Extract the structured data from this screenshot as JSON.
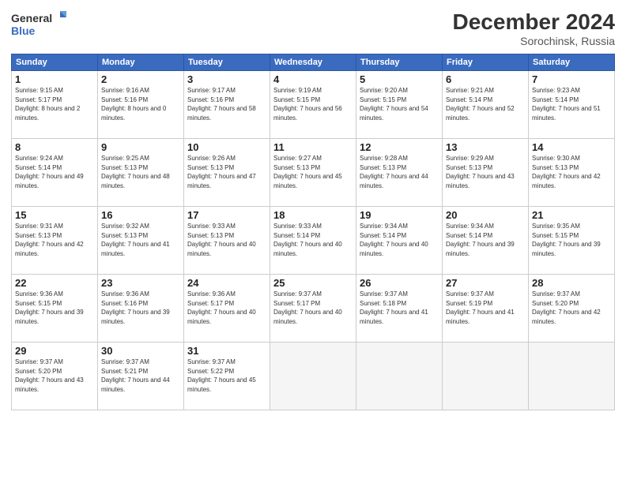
{
  "header": {
    "logo_line1": "General",
    "logo_line2": "Blue",
    "month": "December 2024",
    "location": "Sorochinsk, Russia"
  },
  "weekdays": [
    "Sunday",
    "Monday",
    "Tuesday",
    "Wednesday",
    "Thursday",
    "Friday",
    "Saturday"
  ],
  "weeks": [
    [
      {
        "day": "1",
        "rise": "Sunrise: 9:15 AM",
        "set": "Sunset: 5:17 PM",
        "daylight": "Daylight: 8 hours and 2 minutes."
      },
      {
        "day": "2",
        "rise": "Sunrise: 9:16 AM",
        "set": "Sunset: 5:16 PM",
        "daylight": "Daylight: 8 hours and 0 minutes."
      },
      {
        "day": "3",
        "rise": "Sunrise: 9:17 AM",
        "set": "Sunset: 5:16 PM",
        "daylight": "Daylight: 7 hours and 58 minutes."
      },
      {
        "day": "4",
        "rise": "Sunrise: 9:19 AM",
        "set": "Sunset: 5:15 PM",
        "daylight": "Daylight: 7 hours and 56 minutes."
      },
      {
        "day": "5",
        "rise": "Sunrise: 9:20 AM",
        "set": "Sunset: 5:15 PM",
        "daylight": "Daylight: 7 hours and 54 minutes."
      },
      {
        "day": "6",
        "rise": "Sunrise: 9:21 AM",
        "set": "Sunset: 5:14 PM",
        "daylight": "Daylight: 7 hours and 52 minutes."
      },
      {
        "day": "7",
        "rise": "Sunrise: 9:23 AM",
        "set": "Sunset: 5:14 PM",
        "daylight": "Daylight: 7 hours and 51 minutes."
      }
    ],
    [
      {
        "day": "8",
        "rise": "Sunrise: 9:24 AM",
        "set": "Sunset: 5:14 PM",
        "daylight": "Daylight: 7 hours and 49 minutes."
      },
      {
        "day": "9",
        "rise": "Sunrise: 9:25 AM",
        "set": "Sunset: 5:13 PM",
        "daylight": "Daylight: 7 hours and 48 minutes."
      },
      {
        "day": "10",
        "rise": "Sunrise: 9:26 AM",
        "set": "Sunset: 5:13 PM",
        "daylight": "Daylight: 7 hours and 47 minutes."
      },
      {
        "day": "11",
        "rise": "Sunrise: 9:27 AM",
        "set": "Sunset: 5:13 PM",
        "daylight": "Daylight: 7 hours and 45 minutes."
      },
      {
        "day": "12",
        "rise": "Sunrise: 9:28 AM",
        "set": "Sunset: 5:13 PM",
        "daylight": "Daylight: 7 hours and 44 minutes."
      },
      {
        "day": "13",
        "rise": "Sunrise: 9:29 AM",
        "set": "Sunset: 5:13 PM",
        "daylight": "Daylight: 7 hours and 43 minutes."
      },
      {
        "day": "14",
        "rise": "Sunrise: 9:30 AM",
        "set": "Sunset: 5:13 PM",
        "daylight": "Daylight: 7 hours and 42 minutes."
      }
    ],
    [
      {
        "day": "15",
        "rise": "Sunrise: 9:31 AM",
        "set": "Sunset: 5:13 PM",
        "daylight": "Daylight: 7 hours and 42 minutes."
      },
      {
        "day": "16",
        "rise": "Sunrise: 9:32 AM",
        "set": "Sunset: 5:13 PM",
        "daylight": "Daylight: 7 hours and 41 minutes."
      },
      {
        "day": "17",
        "rise": "Sunrise: 9:33 AM",
        "set": "Sunset: 5:13 PM",
        "daylight": "Daylight: 7 hours and 40 minutes."
      },
      {
        "day": "18",
        "rise": "Sunrise: 9:33 AM",
        "set": "Sunset: 5:14 PM",
        "daylight": "Daylight: 7 hours and 40 minutes."
      },
      {
        "day": "19",
        "rise": "Sunrise: 9:34 AM",
        "set": "Sunset: 5:14 PM",
        "daylight": "Daylight: 7 hours and 40 minutes."
      },
      {
        "day": "20",
        "rise": "Sunrise: 9:34 AM",
        "set": "Sunset: 5:14 PM",
        "daylight": "Daylight: 7 hours and 39 minutes."
      },
      {
        "day": "21",
        "rise": "Sunrise: 9:35 AM",
        "set": "Sunset: 5:15 PM",
        "daylight": "Daylight: 7 hours and 39 minutes."
      }
    ],
    [
      {
        "day": "22",
        "rise": "Sunrise: 9:36 AM",
        "set": "Sunset: 5:15 PM",
        "daylight": "Daylight: 7 hours and 39 minutes."
      },
      {
        "day": "23",
        "rise": "Sunrise: 9:36 AM",
        "set": "Sunset: 5:16 PM",
        "daylight": "Daylight: 7 hours and 39 minutes."
      },
      {
        "day": "24",
        "rise": "Sunrise: 9:36 AM",
        "set": "Sunset: 5:17 PM",
        "daylight": "Daylight: 7 hours and 40 minutes."
      },
      {
        "day": "25",
        "rise": "Sunrise: 9:37 AM",
        "set": "Sunset: 5:17 PM",
        "daylight": "Daylight: 7 hours and 40 minutes."
      },
      {
        "day": "26",
        "rise": "Sunrise: 9:37 AM",
        "set": "Sunset: 5:18 PM",
        "daylight": "Daylight: 7 hours and 41 minutes."
      },
      {
        "day": "27",
        "rise": "Sunrise: 9:37 AM",
        "set": "Sunset: 5:19 PM",
        "daylight": "Daylight: 7 hours and 41 minutes."
      },
      {
        "day": "28",
        "rise": "Sunrise: 9:37 AM",
        "set": "Sunset: 5:20 PM",
        "daylight": "Daylight: 7 hours and 42 minutes."
      }
    ],
    [
      {
        "day": "29",
        "rise": "Sunrise: 9:37 AM",
        "set": "Sunset: 5:20 PM",
        "daylight": "Daylight: 7 hours and 43 minutes."
      },
      {
        "day": "30",
        "rise": "Sunrise: 9:37 AM",
        "set": "Sunset: 5:21 PM",
        "daylight": "Daylight: 7 hours and 44 minutes."
      },
      {
        "day": "31",
        "rise": "Sunrise: 9:37 AM",
        "set": "Sunset: 5:22 PM",
        "daylight": "Daylight: 7 hours and 45 minutes."
      },
      null,
      null,
      null,
      null
    ]
  ]
}
